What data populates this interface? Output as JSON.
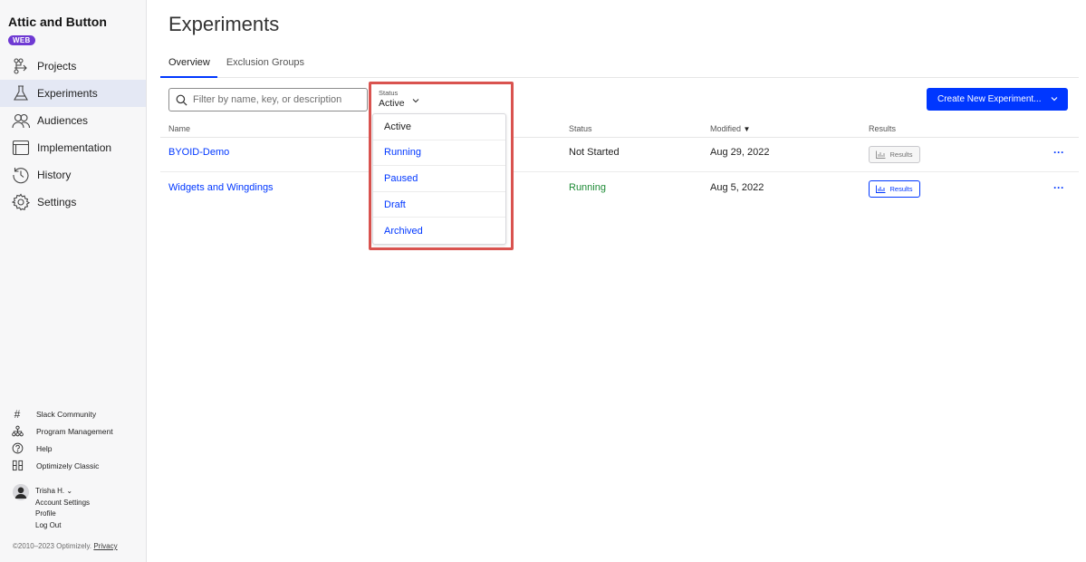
{
  "sidebar": {
    "project_name": "Attic and Button",
    "platform_badge": "WEB",
    "nav": [
      {
        "label": "Projects",
        "icon": "projects-icon",
        "active": false
      },
      {
        "label": "Experiments",
        "icon": "flask-icon",
        "active": true
      },
      {
        "label": "Audiences",
        "icon": "audiences-icon",
        "active": false
      },
      {
        "label": "Implementation",
        "icon": "window-icon",
        "active": false
      },
      {
        "label": "History",
        "icon": "history-icon",
        "active": false
      },
      {
        "label": "Settings",
        "icon": "gear-icon",
        "active": false
      }
    ],
    "utilities": [
      {
        "label": "Slack Community",
        "icon": "hashtag-icon"
      },
      {
        "label": "Program Management",
        "icon": "org-chart-icon"
      },
      {
        "label": "Help",
        "icon": "help-icon"
      },
      {
        "label": "Optimizely Classic",
        "icon": "classic-icon"
      }
    ],
    "account": {
      "user_name": "Trisha H.",
      "account_settings": "Account Settings",
      "profile": "Profile",
      "logout": "Log Out"
    },
    "copyright": "©2010–2023 Optimizely.",
    "privacy": "Privacy"
  },
  "main": {
    "title": "Experiments",
    "tabs": [
      {
        "label": "Overview",
        "active": true
      },
      {
        "label": "Exclusion Groups",
        "active": false
      }
    ],
    "search_placeholder": "Filter by name, key, or description",
    "create_button": "Create New Experiment...",
    "status_filter": {
      "label": "Status",
      "value": "Active",
      "options": [
        "Active",
        "Running",
        "Paused",
        "Draft",
        "Archived"
      ]
    },
    "table": {
      "columns": {
        "name": "Name",
        "status": "Status",
        "modified": "Modified",
        "results": "Results"
      },
      "rows": [
        {
          "name": "BYOID-Demo",
          "status": "Not Started",
          "modified": "Aug 29, 2022",
          "results": "Results",
          "results_enabled": false
        },
        {
          "name": "Widgets and Wingdings",
          "status": "Running",
          "modified": "Aug 5, 2022",
          "results": "Results",
          "results_enabled": true
        }
      ]
    }
  },
  "colors": {
    "accent": "#0037ff",
    "badge": "#6f3ad3",
    "running": "#1d8a35",
    "highlight_outline": "#d9534f",
    "active_nav_bg": "#e4e8f4"
  }
}
